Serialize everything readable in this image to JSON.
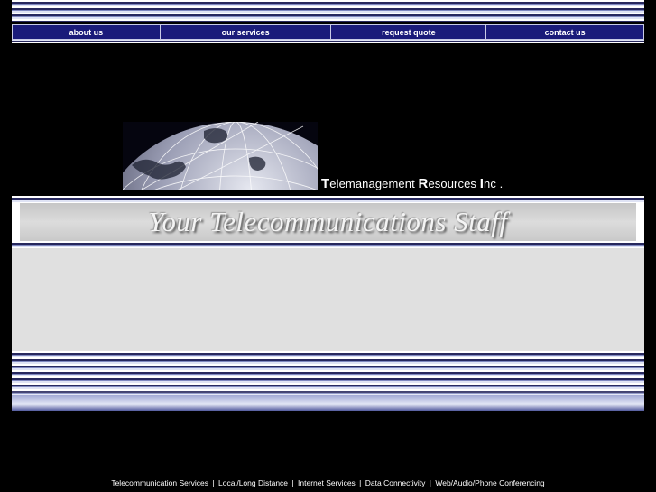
{
  "nav": {
    "items": [
      {
        "label": "about us"
      },
      {
        "label": "our services"
      },
      {
        "label": "request quote"
      },
      {
        "label": "contact us"
      }
    ]
  },
  "brand": {
    "company_name_parts": [
      "T",
      "elemanagement ",
      "R",
      "esources ",
      "I",
      "nc ."
    ],
    "tagline": "Your Telecommunications Staff"
  },
  "footer": {
    "links": [
      {
        "label": "Telecommunication Services"
      },
      {
        "label": "Local/Long Distance"
      },
      {
        "label": "Internet Services"
      },
      {
        "label": "Data Connectivity"
      },
      {
        "label": "Web/Audio/Phone Conferencing"
      }
    ],
    "separator": "|"
  },
  "colors": {
    "nav_background": "#1a1b7a",
    "stripe_dark": "#27285e",
    "content_background": "#e0e0e0"
  }
}
